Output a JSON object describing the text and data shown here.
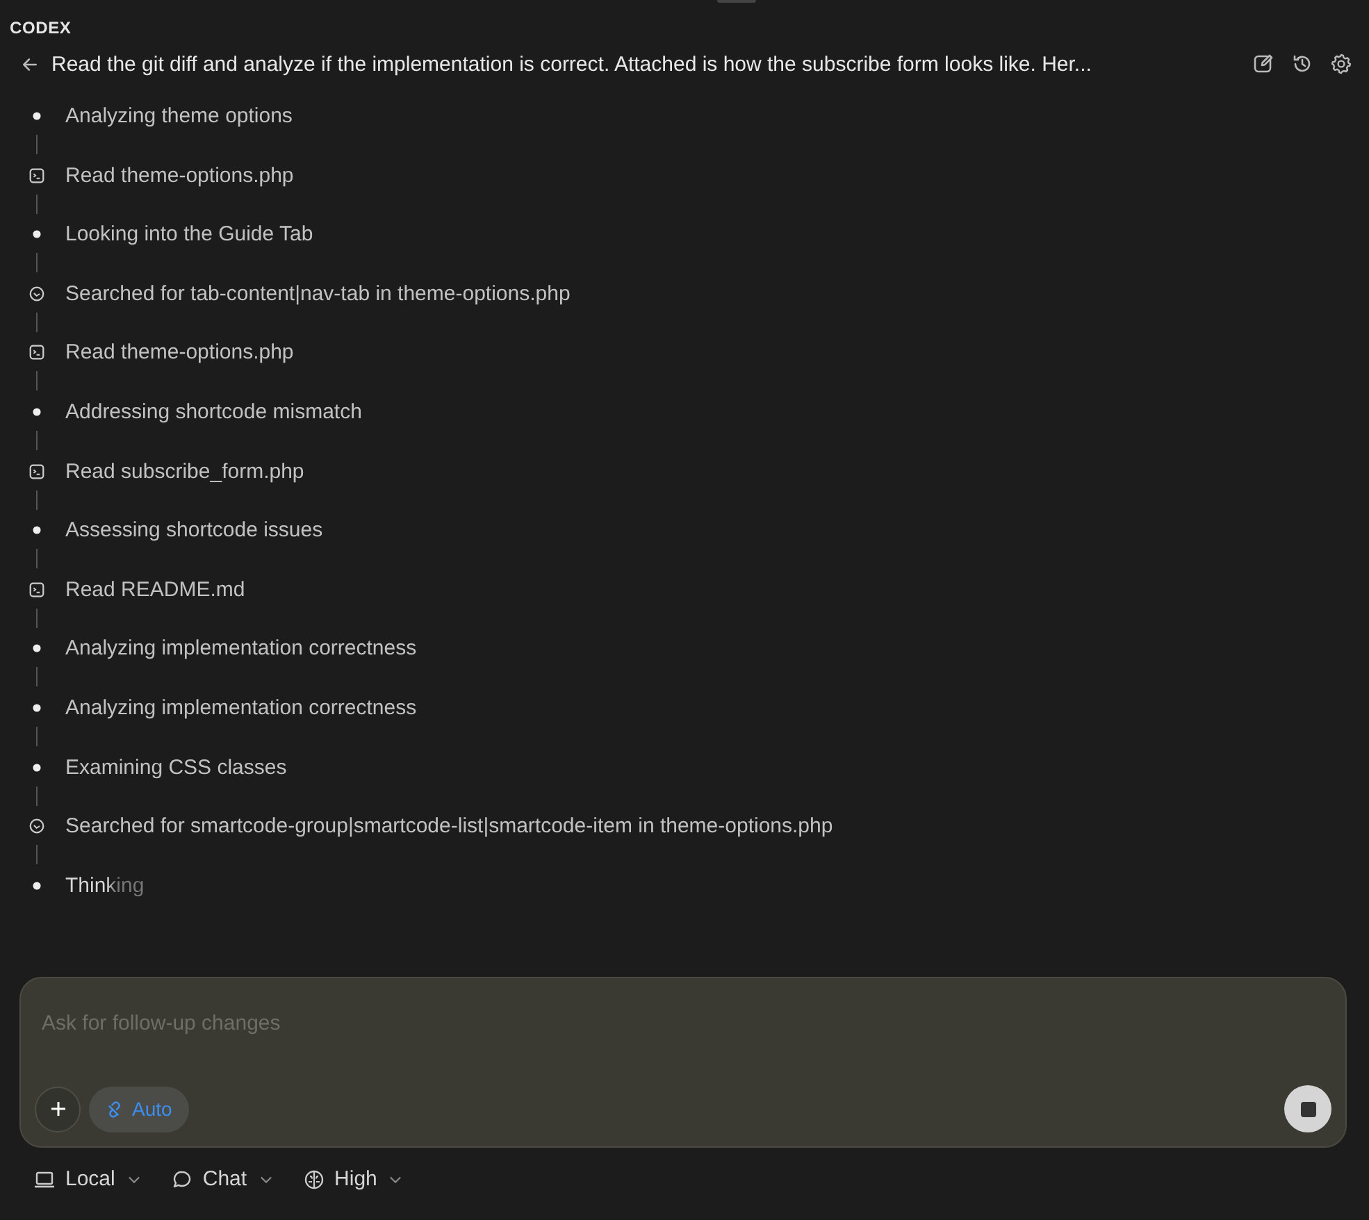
{
  "app": {
    "name": "CODEX"
  },
  "header": {
    "title": "Read the git diff and analyze if the implementation is correct. Attached is how the subscribe form looks like. Her..."
  },
  "steps": [
    {
      "kind": "thought",
      "text": "Analyzing theme options",
      "in_progress": false
    },
    {
      "kind": "read",
      "text": "Read theme-options.php",
      "in_progress": false
    },
    {
      "kind": "thought",
      "text": "Looking into the Guide Tab",
      "in_progress": false
    },
    {
      "kind": "search",
      "text": "Searched for tab-content|nav-tab in theme-options.php",
      "in_progress": false
    },
    {
      "kind": "read",
      "text": "Read theme-options.php",
      "in_progress": false
    },
    {
      "kind": "thought",
      "text": "Addressing shortcode mismatch",
      "in_progress": false
    },
    {
      "kind": "read",
      "text": "Read subscribe_form.php",
      "in_progress": false
    },
    {
      "kind": "thought",
      "text": "Assessing shortcode issues",
      "in_progress": false
    },
    {
      "kind": "read",
      "text": "Read README.md",
      "in_progress": false
    },
    {
      "kind": "thought",
      "text": "Analyzing implementation correctness",
      "in_progress": false
    },
    {
      "kind": "thought",
      "text": "Analyzing implementation correctness",
      "in_progress": false
    },
    {
      "kind": "thought",
      "text": "Examining CSS classes",
      "in_progress": false
    },
    {
      "kind": "search",
      "text": "Searched for smartcode-group|smartcode-list|smartcode-item in theme-options.php",
      "in_progress": false
    },
    {
      "kind": "thought",
      "text": "Thinking",
      "in_progress": true
    }
  ],
  "composer": {
    "placeholder": "Ask for follow-up changes",
    "mode": "Auto"
  },
  "footer": [
    {
      "kind": "laptop",
      "label": "Local"
    },
    {
      "kind": "chat",
      "label": "Chat"
    },
    {
      "kind": "brain",
      "label": "High"
    }
  ]
}
